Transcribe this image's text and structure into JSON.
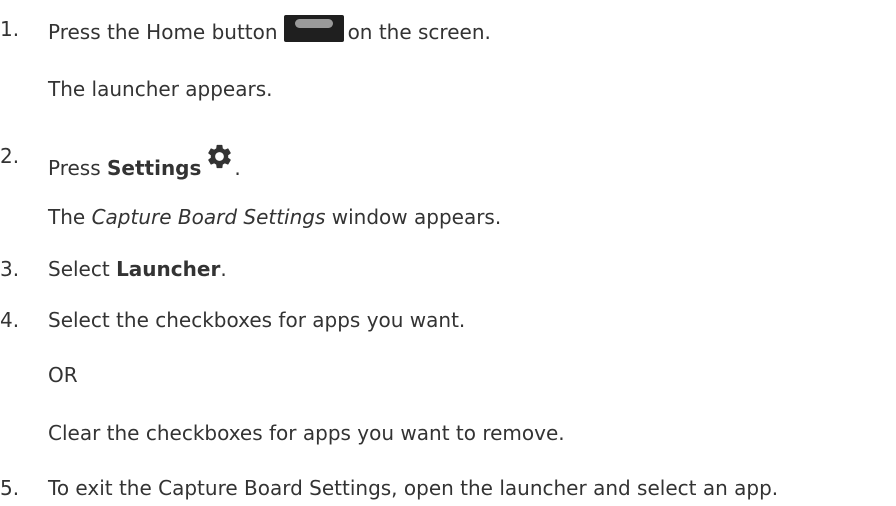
{
  "steps": [
    {
      "number": "1.",
      "before": "Press the Home button",
      "after": "on the screen.",
      "result": "The launcher appears."
    },
    {
      "number": "2.",
      "prefix": "Press ",
      "bold": "Settings",
      "suffix": ".",
      "result_prefix": "The ",
      "result_italic": "Capture Board Settings",
      "result_suffix": " window appears."
    },
    {
      "number": "3.",
      "prefix": "Select ",
      "bold": "Launcher",
      "suffix": "."
    },
    {
      "number": "4.",
      "text": "Select the checkboxes for apps you want.",
      "or": "OR",
      "alt": "Clear the checkboxes for apps you want to remove."
    },
    {
      "number": "5.",
      "text": "To exit the Capture Board Settings, open the launcher and select an app."
    }
  ],
  "icons": {
    "home_button": "home-button-icon",
    "settings": "gear-icon"
  }
}
